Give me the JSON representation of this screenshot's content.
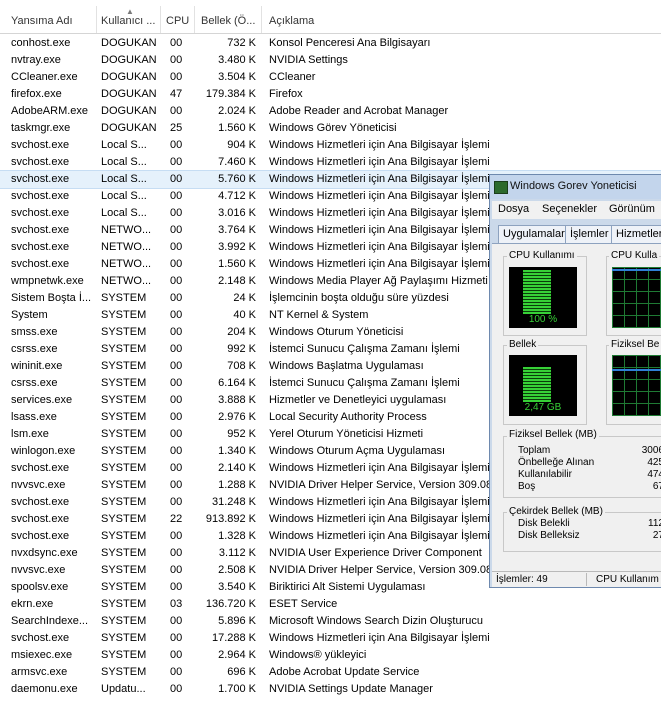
{
  "columns": {
    "name": "Yansıma Adı",
    "user": "Kullanıcı ...",
    "cpu": "CPU",
    "memory": "Bellek (Ö...",
    "description": "Açıklama"
  },
  "rows": [
    {
      "name": "conhost.exe",
      "user": "DOGUKAN",
      "cpu": "00",
      "memory": "732 K",
      "description": "Konsol Penceresi Ana Bilgisayarı"
    },
    {
      "name": "nvtray.exe",
      "user": "DOGUKAN",
      "cpu": "00",
      "memory": "3.480 K",
      "description": "NVIDIA Settings"
    },
    {
      "name": "CCleaner.exe",
      "user": "DOGUKAN",
      "cpu": "00",
      "memory": "3.504 K",
      "description": "CCleaner"
    },
    {
      "name": "firefox.exe",
      "user": "DOGUKAN",
      "cpu": "47",
      "memory": "179.384 K",
      "description": "Firefox"
    },
    {
      "name": "AdobeARM.exe",
      "user": "DOGUKAN",
      "cpu": "00",
      "memory": "2.024 K",
      "description": "Adobe Reader and Acrobat Manager"
    },
    {
      "name": "taskmgr.exe",
      "user": "DOGUKAN",
      "cpu": "25",
      "memory": "1.560 K",
      "description": "Windows Görev Yöneticisi"
    },
    {
      "name": "svchost.exe",
      "user": "Local S...",
      "cpu": "00",
      "memory": "904 K",
      "description": "Windows Hizmetleri için Ana Bilgisayar İşlemi"
    },
    {
      "name": "svchost.exe",
      "user": "Local S...",
      "cpu": "00",
      "memory": "7.460 K",
      "description": "Windows Hizmetleri için Ana Bilgisayar İşlemi"
    },
    {
      "name": "svchost.exe",
      "user": "Local S...",
      "cpu": "00",
      "memory": "5.760 K",
      "description": "Windows Hizmetleri için Ana Bilgisayar İşlemi",
      "selected": true
    },
    {
      "name": "svchost.exe",
      "user": "Local S...",
      "cpu": "00",
      "memory": "4.712 K",
      "description": "Windows Hizmetleri için Ana Bilgisayar İşlemi"
    },
    {
      "name": "svchost.exe",
      "user": "Local S...",
      "cpu": "00",
      "memory": "3.016 K",
      "description": "Windows Hizmetleri için Ana Bilgisayar İşlemi"
    },
    {
      "name": "svchost.exe",
      "user": "NETWO...",
      "cpu": "00",
      "memory": "3.764 K",
      "description": "Windows Hizmetleri için Ana Bilgisayar İşlemi"
    },
    {
      "name": "svchost.exe",
      "user": "NETWO...",
      "cpu": "00",
      "memory": "3.992 K",
      "description": "Windows Hizmetleri için Ana Bilgisayar İşlemi"
    },
    {
      "name": "svchost.exe",
      "user": "NETWO...",
      "cpu": "00",
      "memory": "1.560 K",
      "description": "Windows Hizmetleri için Ana Bilgisayar İşlemi"
    },
    {
      "name": "wmpnetwk.exe",
      "user": "NETWO...",
      "cpu": "00",
      "memory": "2.148 K",
      "description": "Windows Media Player Ağ Paylaşımı Hizmeti"
    },
    {
      "name": "Sistem Boşta İ...",
      "user": "SYSTEM",
      "cpu": "00",
      "memory": "24 K",
      "description": "İşlemcinin boşta olduğu süre yüzdesi"
    },
    {
      "name": "System",
      "user": "SYSTEM",
      "cpu": "00",
      "memory": "40 K",
      "description": "NT Kernel & System"
    },
    {
      "name": "smss.exe",
      "user": "SYSTEM",
      "cpu": "00",
      "memory": "204 K",
      "description": "Windows Oturum Yöneticisi"
    },
    {
      "name": "csrss.exe",
      "user": "SYSTEM",
      "cpu": "00",
      "memory": "992 K",
      "description": "İstemci Sunucu Çalışma Zamanı İşlemi"
    },
    {
      "name": "wininit.exe",
      "user": "SYSTEM",
      "cpu": "00",
      "memory": "708 K",
      "description": "Windows Başlatma Uygulaması"
    },
    {
      "name": "csrss.exe",
      "user": "SYSTEM",
      "cpu": "00",
      "memory": "6.164 K",
      "description": "İstemci Sunucu Çalışma Zamanı İşlemi"
    },
    {
      "name": "services.exe",
      "user": "SYSTEM",
      "cpu": "00",
      "memory": "3.888 K",
      "description": "Hizmetler ve Denetleyici uygulaması"
    },
    {
      "name": "lsass.exe",
      "user": "SYSTEM",
      "cpu": "00",
      "memory": "2.976 K",
      "description": "Local Security Authority Process"
    },
    {
      "name": "lsm.exe",
      "user": "SYSTEM",
      "cpu": "00",
      "memory": "952 K",
      "description": "Yerel Oturum Yöneticisi Hizmeti"
    },
    {
      "name": "winlogon.exe",
      "user": "SYSTEM",
      "cpu": "00",
      "memory": "1.340 K",
      "description": "Windows Oturum Açma Uygulaması"
    },
    {
      "name": "svchost.exe",
      "user": "SYSTEM",
      "cpu": "00",
      "memory": "2.140 K",
      "description": "Windows Hizmetleri için Ana Bilgisayar İşlemi"
    },
    {
      "name": "nvvsvc.exe",
      "user": "SYSTEM",
      "cpu": "00",
      "memory": "1.288 K",
      "description": "NVIDIA Driver Helper Service, Version 309.08"
    },
    {
      "name": "svchost.exe",
      "user": "SYSTEM",
      "cpu": "00",
      "memory": "31.248 K",
      "description": "Windows Hizmetleri için Ana Bilgisayar İşlemi"
    },
    {
      "name": "svchost.exe",
      "user": "SYSTEM",
      "cpu": "22",
      "memory": "913.892 K",
      "description": "Windows Hizmetleri için Ana Bilgisayar İşlemi"
    },
    {
      "name": "svchost.exe",
      "user": "SYSTEM",
      "cpu": "00",
      "memory": "1.328 K",
      "description": "Windows Hizmetleri için Ana Bilgisayar İşlemi"
    },
    {
      "name": "nvxdsync.exe",
      "user": "SYSTEM",
      "cpu": "00",
      "memory": "3.112 K",
      "description": "NVIDIA User Experience Driver Component"
    },
    {
      "name": "nvvsvc.exe",
      "user": "SYSTEM",
      "cpu": "00",
      "memory": "2.508 K",
      "description": "NVIDIA Driver Helper Service, Version 309.08"
    },
    {
      "name": "spoolsv.exe",
      "user": "SYSTEM",
      "cpu": "00",
      "memory": "3.540 K",
      "description": "Biriktirici Alt Sistemi Uygulaması"
    },
    {
      "name": "ekrn.exe",
      "user": "SYSTEM",
      "cpu": "03",
      "memory": "136.720 K",
      "description": "ESET Service"
    },
    {
      "name": "SearchIndexe...",
      "user": "SYSTEM",
      "cpu": "00",
      "memory": "5.896 K",
      "description": "Microsoft Windows Search Dizin Oluşturucu"
    },
    {
      "name": "svchost.exe",
      "user": "SYSTEM",
      "cpu": "00",
      "memory": "17.288 K",
      "description": "Windows Hizmetleri için Ana Bilgisayar İşlemi"
    },
    {
      "name": "msiexec.exe",
      "user": "SYSTEM",
      "cpu": "00",
      "memory": "2.964 K",
      "description": "Windows® yükleyici"
    },
    {
      "name": "armsvc.exe",
      "user": "SYSTEM",
      "cpu": "00",
      "memory": "696 K",
      "description": "Adobe Acrobat Update Service"
    },
    {
      "name": "daemonu.exe",
      "user": "Updatu...",
      "cpu": "00",
      "memory": "1.700 K",
      "description": "NVIDIA Settings Update Manager"
    }
  ],
  "taskmgr": {
    "title": "Windows Gorev Yoneticisi",
    "menu": [
      "Dosya",
      "Seçenekler",
      "Görünüm"
    ],
    "tabs": [
      "Uygulamalar",
      "İşlemler",
      "Hizmetler"
    ],
    "cpu_label": "CPU Kullanımı",
    "cpu_history_label": "CPU Kulla",
    "cpu_value": "100 %",
    "cpu_fraction": 1.0,
    "memory_label": "Bellek",
    "physical_history_label": "Fiziksel Be",
    "memory_value": "2,47 GB",
    "memory_fraction": 0.8,
    "physical_memory_title": "Fiziksel Bellek (MB)",
    "physical_rows": [
      {
        "label": "Toplam",
        "value": "3006"
      },
      {
        "label": "Önbelleğe Alınan",
        "value": "425"
      },
      {
        "label": "Kullanılabilir",
        "value": "474"
      },
      {
        "label": "Boş",
        "value": "67"
      }
    ],
    "kernel_memory_title": "Çekirdek Bellek (MB)",
    "kernel_rows": [
      {
        "label": "Disk Belekli",
        "value": "112"
      },
      {
        "label": "Disk Belleksiz",
        "value": "27"
      }
    ],
    "status_processes": "İşlemler: 49",
    "status_cpu": "CPU Kullanım"
  },
  "colors": {
    "selected_row": "#e5f1fb",
    "meter_green": "#37d137",
    "window_frame": "#cbd9ea"
  }
}
